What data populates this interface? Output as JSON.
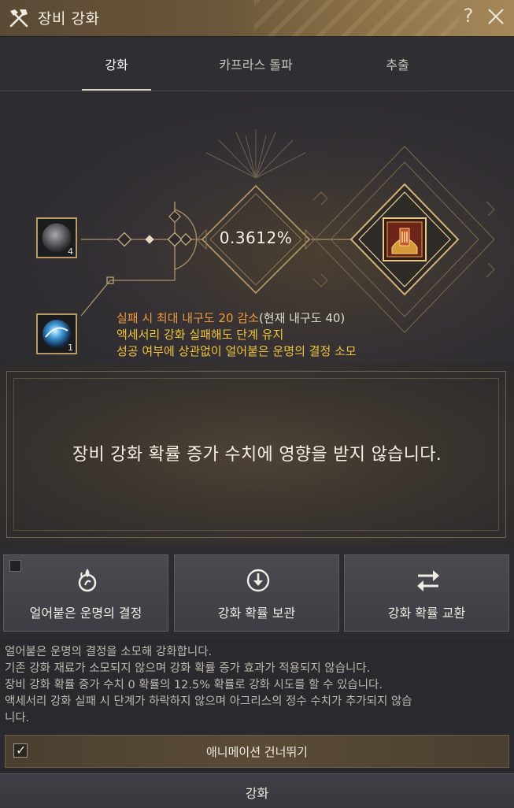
{
  "window": {
    "title": "장비 강화",
    "help": "?"
  },
  "tabs": [
    {
      "label": "강화",
      "active": true
    },
    {
      "label": "카프라스 돌파",
      "active": false
    },
    {
      "label": "추출",
      "active": false
    }
  ],
  "stage": {
    "rate": "0.3612%",
    "material_slot_1": {
      "count": "4",
      "icon": "gray-stone-icon"
    },
    "material_slot_2": {
      "count": "1",
      "icon": "blue-crystal-icon"
    },
    "result_item_icon": "gold-armor-chest-icon",
    "info": {
      "line1_highlight": "실패 시 최대 내구도 20 감소",
      "line1_tail": "(현재 내구도 40)",
      "line2": "액세서리 강화 실패해도 단계 유지",
      "line3": "성공 여부에 상관없이 얼어붙은 운명의 결정 소모"
    }
  },
  "notice": {
    "text": "장비 강화 확률 증가 수치에 영향을 받지 않습니다."
  },
  "buttons": {
    "frozen_fate": "얼어붙은 운명의 결정",
    "store_rate": "강화 확률 보관",
    "exchange_rate": "강화 확률 교환"
  },
  "description": [
    "얼어붙은 운명의 결정을 소모해 강화합니다.",
    "기존 강화 재료가 소모되지 않으며 강화 확률 증가 효과가 적용되지 않습니다.",
    "장비 강화 확률 증가 수치 0 확률의 12.5% 확률로 강화 시도를 할 수 있습니다.",
    "액세서리 강화 실패 시 단계가 하락하지 않으며 아그리스의 정수 수치가 추가되지 않습",
    "니다."
  ],
  "skip_animation": {
    "label": "애니메이션 건너뛰기",
    "checked": true
  },
  "enhance_button": "강화",
  "colors": {
    "accent_gold": "#b79b67",
    "warning_orange": "#f09a3c",
    "note_yellow": "#f0c43a"
  }
}
